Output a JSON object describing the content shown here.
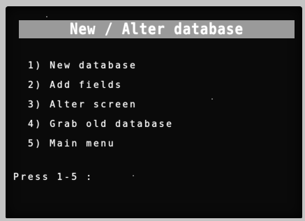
{
  "title": "New / Alter database",
  "menu": {
    "items": [
      {
        "label": "1) New database"
      },
      {
        "label": "2) Add fields"
      },
      {
        "label": "3) Alter screen"
      },
      {
        "label": "4) Grab old database"
      },
      {
        "label": "5) Main menu"
      }
    ]
  },
  "prompt": "Press 1-5 :"
}
